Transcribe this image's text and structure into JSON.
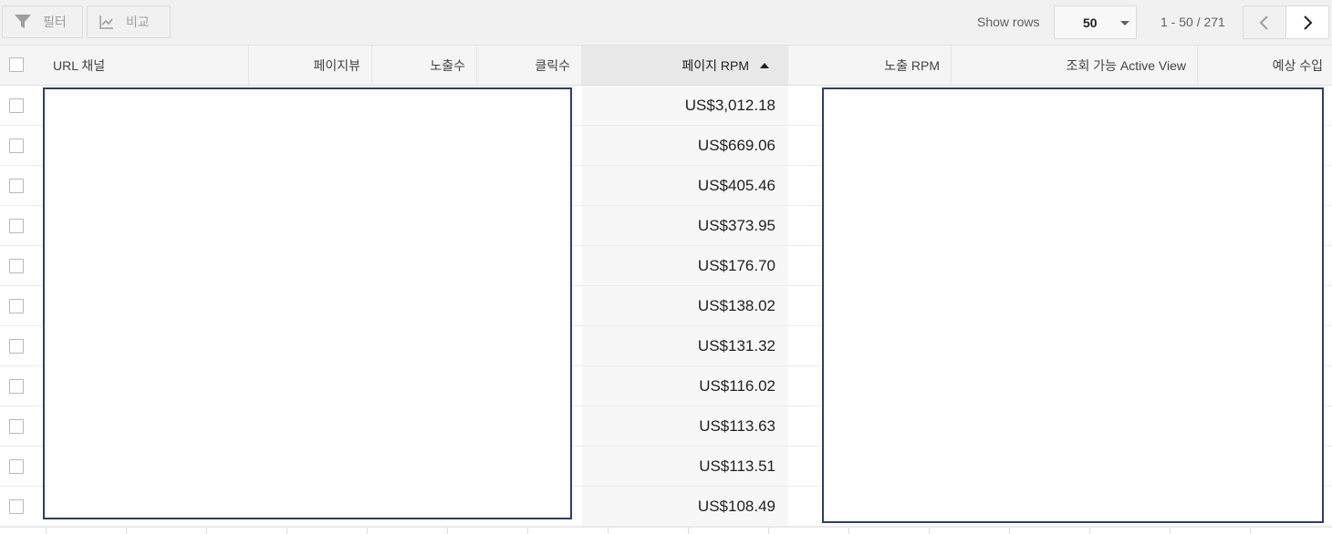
{
  "toolbar": {
    "filter_label": "필터",
    "compare_label": "비교",
    "show_rows_label": "Show rows",
    "rows_per_page": "50",
    "pagination": "1 - 50 / 271"
  },
  "table": {
    "columns": [
      {
        "key": "url_channel",
        "label": "URL 채널"
      },
      {
        "key": "page_views",
        "label": "페이지뷰"
      },
      {
        "key": "impressions",
        "label": "노출수"
      },
      {
        "key": "clicks",
        "label": "클릭수"
      },
      {
        "key": "page_rpm",
        "label": "페이지 RPM",
        "sorted": "ascending"
      },
      {
        "key": "impression_rpm",
        "label": "노출 RPM"
      },
      {
        "key": "active_view",
        "label": "조회 가능 Active View"
      },
      {
        "key": "estimated_earnings",
        "label": "예상 수입"
      }
    ],
    "page_rpm_values": [
      "US$3,012.18",
      "US$669.06",
      "US$405.46",
      "US$373.95",
      "US$176.70",
      "US$138.02",
      "US$131.32",
      "US$116.02",
      "US$113.63",
      "US$113.51",
      "US$108.49"
    ]
  },
  "colors": {
    "redaction_border": "#2e3f6b",
    "toolbar_bg": "#f1f1f1",
    "header_bg": "#f5f5f5",
    "sorted_header_bg": "#e8e8e8"
  }
}
